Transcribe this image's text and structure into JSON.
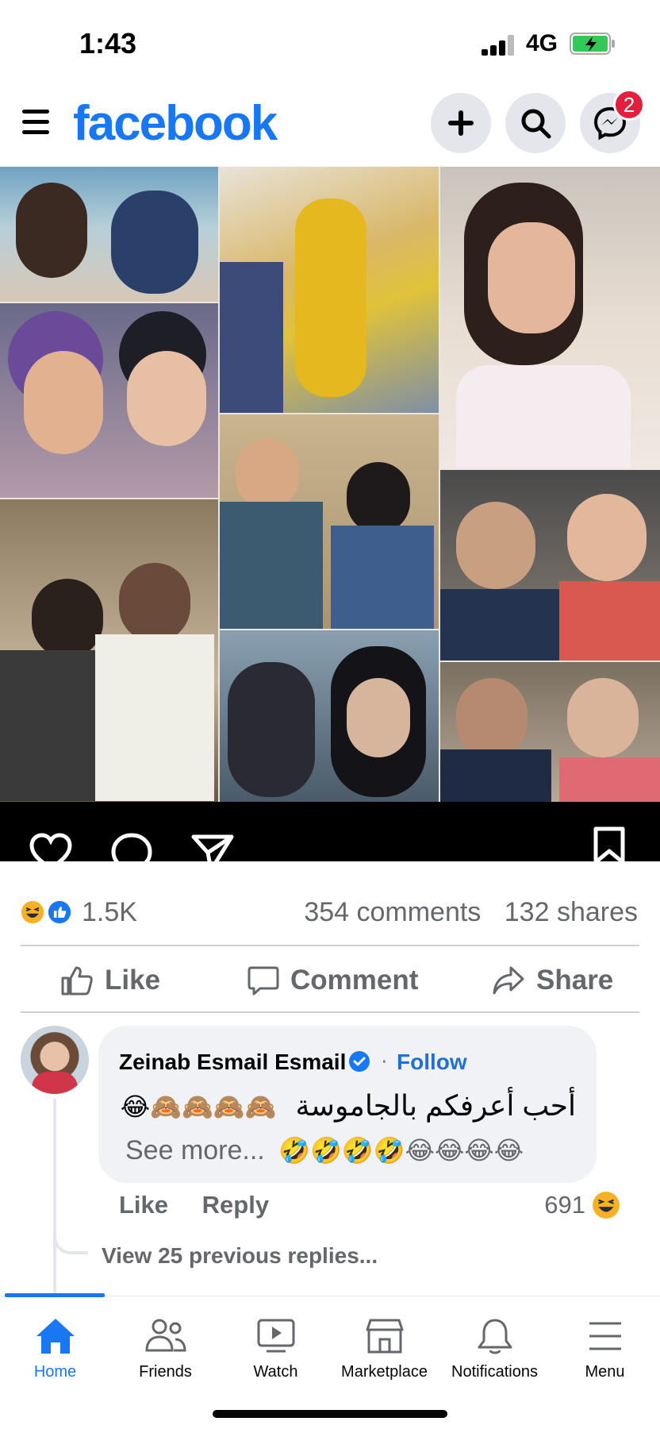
{
  "status_bar": {
    "time": "1:43",
    "network": "4G"
  },
  "header": {
    "logo": "facebook",
    "messenger_badge": "2",
    "icons": [
      "menu-icon",
      "plus-icon",
      "search-icon",
      "messenger-icon"
    ]
  },
  "post": {
    "image_icons": [
      "heart-icon",
      "comment-bubble-icon",
      "send-icon",
      "bookmark-icon"
    ],
    "reactions": {
      "types": [
        "haha",
        "like"
      ],
      "count": "1.5K"
    },
    "comments_count": "354 comments",
    "shares_count": "132 shares",
    "actions": {
      "like": "Like",
      "comment": "Comment",
      "share": "Share"
    }
  },
  "comment": {
    "author": "Zeinab Esmail Esmail",
    "separator": "·",
    "follow": "Follow",
    "text_emojis": "😂🙈🙈🙈🙈",
    "text_arabic": "أحب أعرفكم بالجاموسة",
    "see_more": "See more...",
    "text_emojis_2": "🤣🤣🤣🤣😂😂😂😂",
    "like_label": "Like",
    "reply_label": "Reply",
    "reaction_count": "691",
    "view_replies": "View 25 previous replies..."
  },
  "tabs": [
    {
      "label": "Home",
      "active": true
    },
    {
      "label": "Friends"
    },
    {
      "label": "Watch"
    },
    {
      "label": "Marketplace"
    },
    {
      "label": "Notifications"
    },
    {
      "label": "Menu"
    }
  ],
  "colors": {
    "brand": "#1877f2",
    "badge": "#e41e3f",
    "muted": "#65676b",
    "bubble": "#f0f2f5"
  }
}
